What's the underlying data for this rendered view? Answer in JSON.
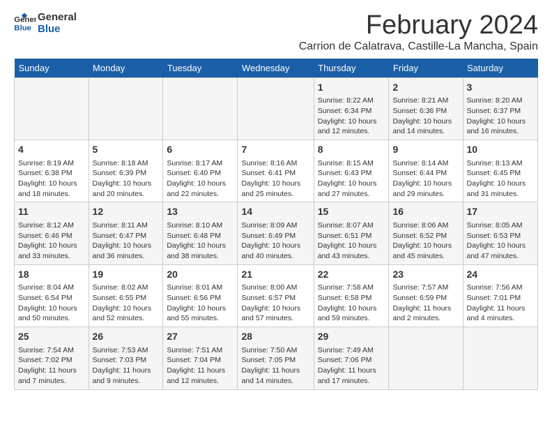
{
  "logo": {
    "line1": "General",
    "line2": "Blue"
  },
  "title": "February 2024",
  "subtitle": "Carrion de Calatrava, Castille-La Mancha, Spain",
  "days_of_week": [
    "Sunday",
    "Monday",
    "Tuesday",
    "Wednesday",
    "Thursday",
    "Friday",
    "Saturday"
  ],
  "weeks": [
    [
      {
        "day": "",
        "info": ""
      },
      {
        "day": "",
        "info": ""
      },
      {
        "day": "",
        "info": ""
      },
      {
        "day": "",
        "info": ""
      },
      {
        "day": "1",
        "info": "Sunrise: 8:22 AM\nSunset: 6:34 PM\nDaylight: 10 hours\nand 12 minutes."
      },
      {
        "day": "2",
        "info": "Sunrise: 8:21 AM\nSunset: 6:36 PM\nDaylight: 10 hours\nand 14 minutes."
      },
      {
        "day": "3",
        "info": "Sunrise: 8:20 AM\nSunset: 6:37 PM\nDaylight: 10 hours\nand 16 minutes."
      }
    ],
    [
      {
        "day": "4",
        "info": "Sunrise: 8:19 AM\nSunset: 6:38 PM\nDaylight: 10 hours\nand 18 minutes."
      },
      {
        "day": "5",
        "info": "Sunrise: 8:18 AM\nSunset: 6:39 PM\nDaylight: 10 hours\nand 20 minutes."
      },
      {
        "day": "6",
        "info": "Sunrise: 8:17 AM\nSunset: 6:40 PM\nDaylight: 10 hours\nand 22 minutes."
      },
      {
        "day": "7",
        "info": "Sunrise: 8:16 AM\nSunset: 6:41 PM\nDaylight: 10 hours\nand 25 minutes."
      },
      {
        "day": "8",
        "info": "Sunrise: 8:15 AM\nSunset: 6:43 PM\nDaylight: 10 hours\nand 27 minutes."
      },
      {
        "day": "9",
        "info": "Sunrise: 8:14 AM\nSunset: 6:44 PM\nDaylight: 10 hours\nand 29 minutes."
      },
      {
        "day": "10",
        "info": "Sunrise: 8:13 AM\nSunset: 6:45 PM\nDaylight: 10 hours\nand 31 minutes."
      }
    ],
    [
      {
        "day": "11",
        "info": "Sunrise: 8:12 AM\nSunset: 6:46 PM\nDaylight: 10 hours\nand 33 minutes."
      },
      {
        "day": "12",
        "info": "Sunrise: 8:11 AM\nSunset: 6:47 PM\nDaylight: 10 hours\nand 36 minutes."
      },
      {
        "day": "13",
        "info": "Sunrise: 8:10 AM\nSunset: 6:48 PM\nDaylight: 10 hours\nand 38 minutes."
      },
      {
        "day": "14",
        "info": "Sunrise: 8:09 AM\nSunset: 6:49 PM\nDaylight: 10 hours\nand 40 minutes."
      },
      {
        "day": "15",
        "info": "Sunrise: 8:07 AM\nSunset: 6:51 PM\nDaylight: 10 hours\nand 43 minutes."
      },
      {
        "day": "16",
        "info": "Sunrise: 8:06 AM\nSunset: 6:52 PM\nDaylight: 10 hours\nand 45 minutes."
      },
      {
        "day": "17",
        "info": "Sunrise: 8:05 AM\nSunset: 6:53 PM\nDaylight: 10 hours\nand 47 minutes."
      }
    ],
    [
      {
        "day": "18",
        "info": "Sunrise: 8:04 AM\nSunset: 6:54 PM\nDaylight: 10 hours\nand 50 minutes."
      },
      {
        "day": "19",
        "info": "Sunrise: 8:02 AM\nSunset: 6:55 PM\nDaylight: 10 hours\nand 52 minutes."
      },
      {
        "day": "20",
        "info": "Sunrise: 8:01 AM\nSunset: 6:56 PM\nDaylight: 10 hours\nand 55 minutes."
      },
      {
        "day": "21",
        "info": "Sunrise: 8:00 AM\nSunset: 6:57 PM\nDaylight: 10 hours\nand 57 minutes."
      },
      {
        "day": "22",
        "info": "Sunrise: 7:58 AM\nSunset: 6:58 PM\nDaylight: 10 hours\nand 59 minutes."
      },
      {
        "day": "23",
        "info": "Sunrise: 7:57 AM\nSunset: 6:59 PM\nDaylight: 11 hours\nand 2 minutes."
      },
      {
        "day": "24",
        "info": "Sunrise: 7:56 AM\nSunset: 7:01 PM\nDaylight: 11 hours\nand 4 minutes."
      }
    ],
    [
      {
        "day": "25",
        "info": "Sunrise: 7:54 AM\nSunset: 7:02 PM\nDaylight: 11 hours\nand 7 minutes."
      },
      {
        "day": "26",
        "info": "Sunrise: 7:53 AM\nSunset: 7:03 PM\nDaylight: 11 hours\nand 9 minutes."
      },
      {
        "day": "27",
        "info": "Sunrise: 7:51 AM\nSunset: 7:04 PM\nDaylight: 11 hours\nand 12 minutes."
      },
      {
        "day": "28",
        "info": "Sunrise: 7:50 AM\nSunset: 7:05 PM\nDaylight: 11 hours\nand 14 minutes."
      },
      {
        "day": "29",
        "info": "Sunrise: 7:49 AM\nSunset: 7:06 PM\nDaylight: 11 hours\nand 17 minutes."
      },
      {
        "day": "",
        "info": ""
      },
      {
        "day": "",
        "info": ""
      }
    ]
  ]
}
